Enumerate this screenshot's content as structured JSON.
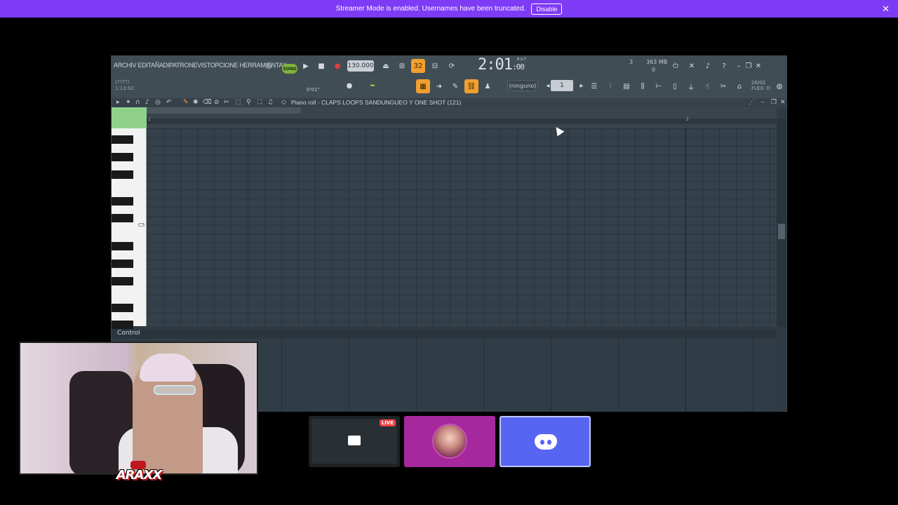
{
  "banner": {
    "message": "Streamer Mode is enabled. Usernames have been truncated.",
    "disable_label": "Disable",
    "close_icon": "close-icon",
    "background": "#7e3bf5"
  },
  "fl": {
    "menu": "ARCHIV EDITAÑADIPATRONEVISTOPCIONE HERRAMIENTAY",
    "mode_label": "SONG",
    "tempo": "130.000",
    "pattern_num": "32",
    "time_main": "2:01",
    "time_sub": ":00",
    "time_unit": "B:S:T",
    "memory": "363 MB",
    "cpu": "3",
    "mem_zero": "0",
    "hint_line1": "(????)",
    "hint_line2": "1:13:02",
    "pitch_hint": "0'01\"",
    "none_label": "(ninguno)",
    "step_value": "1",
    "flex_label": "FLEX: D",
    "flex_date": "26/02"
  },
  "piano_roll": {
    "title": "Piano roll - CLAPS LOOPS SANDUNGUEO Y ONE SHOT (121)",
    "bar1": "1",
    "bar2": "2",
    "c5_label": "C5",
    "control_label": "Control"
  },
  "tiles": {
    "live_label": "LIVE"
  },
  "overlay": {
    "logo_text": "ARAXX"
  }
}
